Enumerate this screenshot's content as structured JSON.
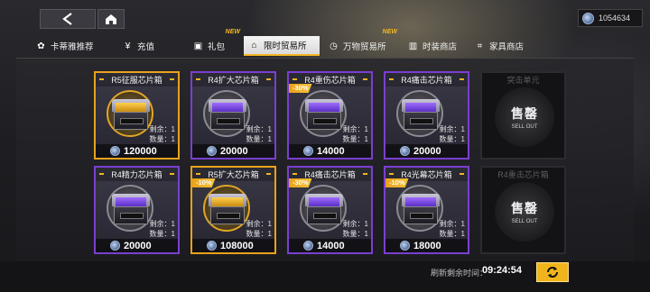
{
  "header": {
    "currency": {
      "icon": "coin-icon",
      "amount": "1054634"
    }
  },
  "tabs": [
    {
      "label": "卡蒂雅推荐",
      "icon": "cat-icon",
      "new": ""
    },
    {
      "label": "充值",
      "icon": "yen-icon",
      "new": ""
    },
    {
      "label": "礼包",
      "icon": "gift-icon",
      "new": "NEW"
    },
    {
      "label": "限时贸易所",
      "icon": "shop-icon",
      "new": "",
      "active": true
    },
    {
      "label": "万物贸易所",
      "icon": "clock-icon",
      "new": "NEW"
    },
    {
      "label": "时装商店",
      "icon": "wardrobe-icon",
      "new": ""
    },
    {
      "label": "家具商店",
      "icon": "sofa-icon",
      "new": ""
    }
  ],
  "items": [
    {
      "name": "R5征服芯片箱",
      "rarity": "gold",
      "discount": "",
      "stock_label": "剩余：1",
      "qty_label": "数量：1",
      "price": "120000"
    },
    {
      "name": "R4扩大芯片箱",
      "rarity": "purple",
      "discount": "",
      "stock_label": "剩余：1",
      "qty_label": "数量：1",
      "price": "20000"
    },
    {
      "name": "R4重伤芯片箱",
      "rarity": "purple",
      "discount": "-30%",
      "stock_label": "剩余：1",
      "qty_label": "数量：1",
      "price": "14000"
    },
    {
      "name": "R4痛击芯片箱",
      "rarity": "purple",
      "discount": "",
      "stock_label": "剩余：1",
      "qty_label": "数量：1",
      "price": "20000"
    },
    {
      "name": "R4精力芯片箱",
      "rarity": "purple",
      "discount": "",
      "stock_label": "剩余：1",
      "qty_label": "数量：1",
      "price": "20000"
    },
    {
      "name": "R5扩大芯片箱",
      "rarity": "gold",
      "discount": "-10%",
      "stock_label": "剩余：1",
      "qty_label": "数量：1",
      "price": "108000"
    },
    {
      "name": "R4痛击芯片箱",
      "rarity": "purple",
      "discount": "-30%",
      "stock_label": "剩余：1",
      "qty_label": "数量：1",
      "price": "14000"
    },
    {
      "name": "R4光幕芯片箱",
      "rarity": "purple",
      "discount": "-10%",
      "stock_label": "剩余：1",
      "qty_label": "数量：1",
      "price": "18000"
    }
  ],
  "soldout": [
    {
      "name": "突击单元",
      "label_zh": "售罄",
      "label_en": "SELL OUT"
    },
    {
      "name": "R4重击芯片箱",
      "label_zh": "售罄",
      "label_en": "SELL OUT"
    }
  ],
  "footer": {
    "refresh_label": "刷新剩余时间：",
    "refresh_time": "09:24:54"
  },
  "colors": {
    "accent": "#f2b522",
    "purple_border": "#7a3fd0",
    "gold_border": "#e8a21a"
  }
}
